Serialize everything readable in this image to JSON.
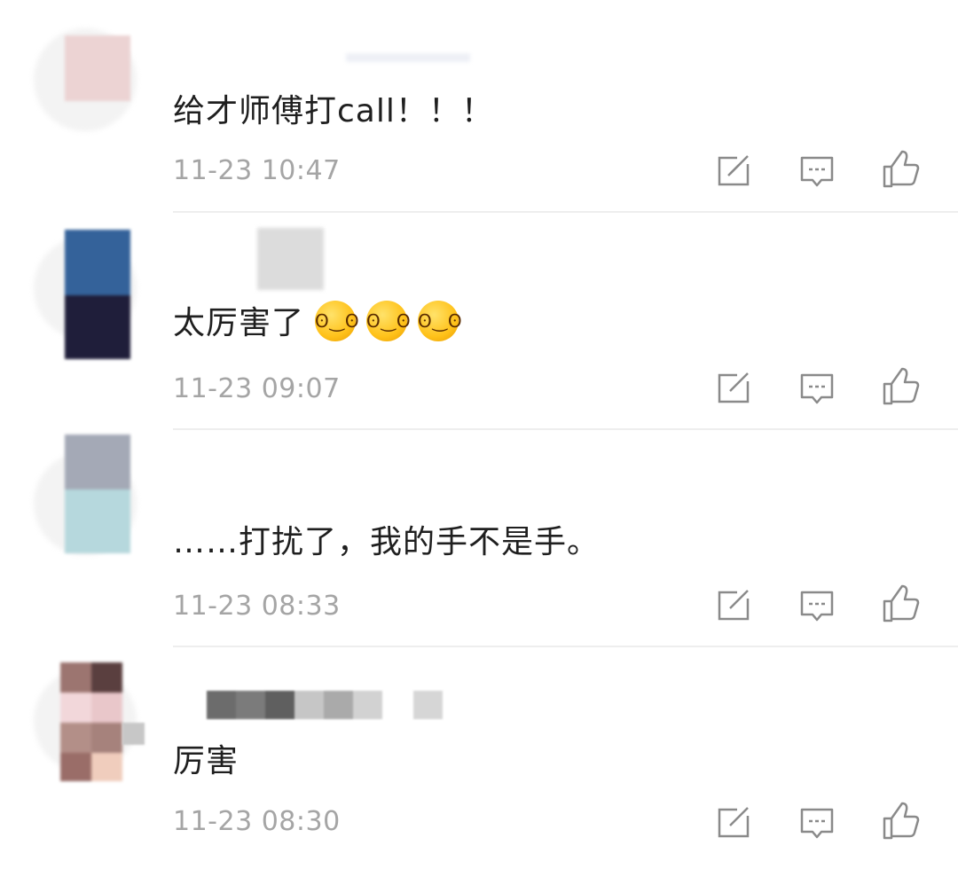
{
  "comments": [
    {
      "text": "给才师傅打call！！！",
      "time": "11-23 10:47",
      "emoji": []
    },
    {
      "text": "太厉害了",
      "time": "11-23 09:07",
      "emoji": [
        "emoji-grin",
        "emoji-grin",
        "emoji-grin"
      ]
    },
    {
      "text": "……打扰了，我的手不是手。",
      "time": "11-23 08:33",
      "emoji": []
    },
    {
      "text": "厉害",
      "time": "11-23 08:30",
      "emoji": []
    }
  ],
  "actions": {
    "icons": [
      "share-icon",
      "reply-icon",
      "like-icon"
    ]
  },
  "colors": {
    "text": "#1f1f1f",
    "time": "#a5a5a5",
    "icon": "#8a8a8a",
    "divider": "#eeeeee"
  }
}
